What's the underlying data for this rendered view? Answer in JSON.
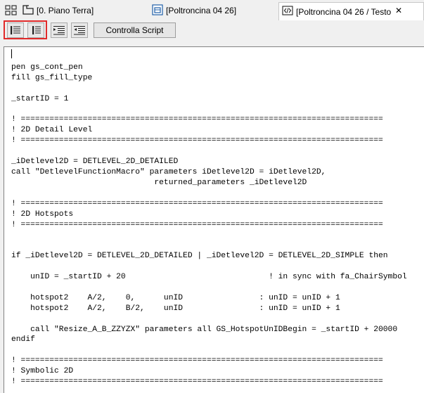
{
  "tabs": [
    {
      "label": "[0. Piano Terra]",
      "icon": "floorplan-icon"
    },
    {
      "label": "[Poltroncina 04 26]",
      "icon": "object-2d-icon"
    },
    {
      "label": "[Poltroncina 04 26 / Testo",
      "icon": "script-code-icon",
      "active": true
    }
  ],
  "toolbar": {
    "buttons": [
      "indent-left-icon",
      "indent-right-icon",
      "indent-more-icon",
      "indent-less-icon"
    ],
    "check_script_label": "Controlla Script"
  },
  "editor": {
    "lines": [
      "",
      "pen gs_cont_pen",
      "fill gs_fill_type",
      "",
      "_startID = 1",
      "",
      "! ============================================================================",
      "! 2D Detail Level",
      "! ============================================================================",
      "",
      "_iDetlevel2D = DETLEVEL_2D_DETAILED",
      "call \"DetlevelFunctionMacro\" parameters iDetlevel2D = iDetlevel2D,",
      "                              returned_parameters _iDetlevel2D",
      "",
      "! ============================================================================",
      "! 2D Hotspots",
      "! ============================================================================",
      "",
      "",
      "if _iDetlevel2D = DETLEVEL_2D_DETAILED | _iDetlevel2D = DETLEVEL_2D_SIMPLE then",
      "",
      "    unID = _startID + 20                              ! in sync with fa_ChairSymbol",
      "",
      "    hotspot2    A/2,    0,      unID                : unID = unID + 1",
      "    hotspot2    A/2,    B/2,    unID                : unID = unID + 1",
      "",
      "    call \"Resize_A_B_ZZYZX\" parameters all GS_HotspotUnIDBegin = _startID + 20000",
      "endif",
      "",
      "! ============================================================================",
      "! Symbolic 2D",
      "! ============================================================================"
    ]
  }
}
